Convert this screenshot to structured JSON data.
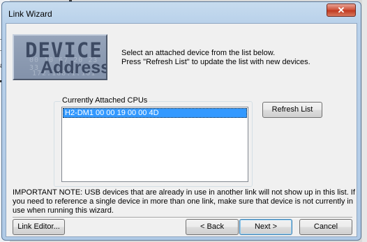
{
  "background": {
    "fragment_text": "ar"
  },
  "window": {
    "title": "Link Wizard",
    "close_glyph": "✕"
  },
  "logo": {
    "line1": "DEVICE",
    "line2": "Address",
    "bg_digits1": "00 10 67 20 23 33",
    "bg_digits2": "172.168.1.101"
  },
  "intro": {
    "line1": "Select an attached device from the list below.",
    "line2": "Press \"Refresh List\" to update the list with new devices."
  },
  "cpus": {
    "group_label": "Currently Attached CPUs",
    "items": [
      {
        "label": "H2-DM1  00 00 19 00 00 4D",
        "selected": true
      }
    ]
  },
  "buttons": {
    "refresh": "Refresh List",
    "link_editor": "Link Editor...",
    "back": "< Back",
    "next": "Next >",
    "cancel": "Cancel"
  },
  "note": "IMPORTANT NOTE: USB devices that are already in use in another link will not show up in this list. If you need to reference a single device in more than one link, make sure that device is not currently in use when running this wizard.",
  "colors": {
    "selection": "#3399ff",
    "logo_text": "#3d4a63",
    "title_bar": "#b9d1ea"
  }
}
